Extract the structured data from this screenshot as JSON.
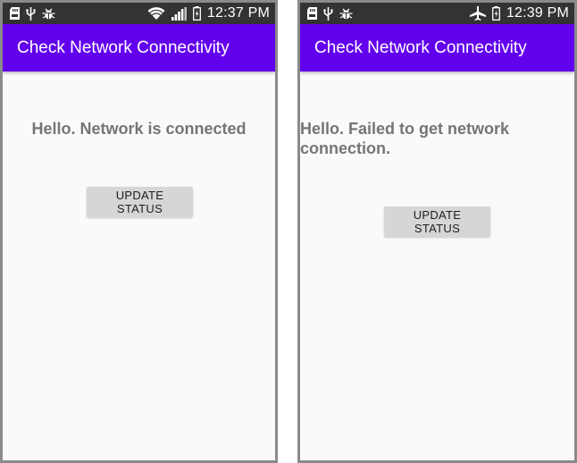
{
  "screens": [
    {
      "status_bar": {
        "time": "12:37 PM",
        "icons": [
          "sd-card-icon",
          "usb-icon",
          "debug-icon",
          "wifi-icon",
          "signal-icon",
          "battery-charging-icon"
        ]
      },
      "app_bar": {
        "title": "Check Network Connectivity"
      },
      "message": "Hello. Network is connected",
      "button_label": "UPDATE STATUS"
    },
    {
      "status_bar": {
        "time": "12:39 PM",
        "icons": [
          "sd-card-icon",
          "usb-icon",
          "debug-icon",
          "airplane-mode-icon",
          "battery-charging-icon"
        ]
      },
      "app_bar": {
        "title": "Check Network Connectivity"
      },
      "message": "Hello. Failed to get network connection.",
      "button_label": "UPDATE STATUS"
    }
  ],
  "colors": {
    "status_bar": "#333333",
    "app_bar": "#6200ee",
    "background": "#fafafa",
    "message_text": "#757575",
    "button": "#d6d6d6"
  }
}
